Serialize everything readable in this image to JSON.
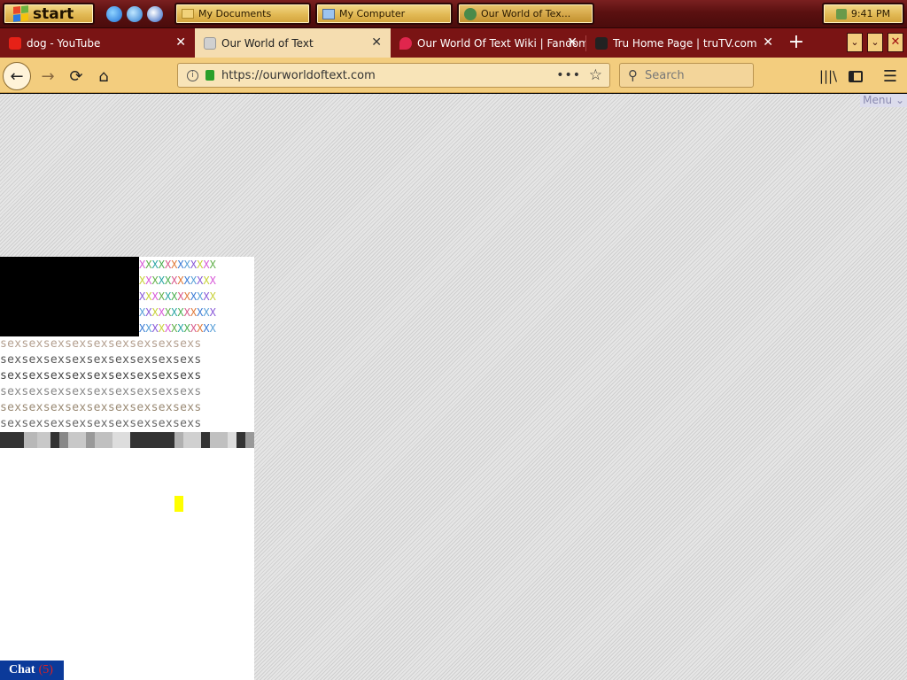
{
  "taskbar": {
    "start_label": "start",
    "windows": [
      {
        "label": "My Documents"
      },
      {
        "label": "My Computer"
      },
      {
        "label": "Our World of Tex..."
      }
    ],
    "clock": "9:41 PM"
  },
  "tabs": [
    {
      "label": "dog - YouTube",
      "icon": "youtube-icon",
      "color": "#e62117"
    },
    {
      "label": "Our World of Text",
      "icon": "page-icon",
      "color": "#9a9a9a"
    },
    {
      "label": "Our World Of Text Wiki | Fandom",
      "icon": "fandom-icon",
      "color": "#e0264d"
    },
    {
      "label": "Tru Home Page | truTV.com",
      "icon": "trutv-icon",
      "color": "#222222"
    }
  ],
  "navbar": {
    "url": "https://ourworldoftext.com",
    "search_placeholder": "Search"
  },
  "page": {
    "menu_label": "Menu",
    "x_rows": [
      "XXXXXXXXXXXX",
      "XXXXXXXXXXXX",
      "XXXXXXXXXXXX",
      "XXXXXXXXXXXX",
      "XXXXXXXXXXXX"
    ],
    "sex_rows": [
      "sexsexsexsexsexsexsexsexsexs",
      "sexsexsexsexsexsexsexsexsexs",
      "sexsexsexsexsexsexsexsexsexs",
      "sexsexsexsexsexsexsexsexsexs",
      "sexsexsexsexsexsexsexsexsexs",
      "sexsexsexsexsexsexsexsexsexs"
    ],
    "chat_label": "Chat",
    "chat_count": "(5)"
  },
  "colors": {
    "x_palette": [
      "#d85ad8",
      "#4caf50",
      "#3a7bd5",
      "#c8d13a",
      "#2ca6a4",
      "#e07a3a",
      "#8a5ad8",
      "#62b04c",
      "#d85a8a",
      "#5aa0d8"
    ],
    "sex_colors": [
      "#b4a090",
      "#555555",
      "#444444",
      "#888888",
      "#9a8a74",
      "#666666"
    ],
    "accent": "#f3cd7e",
    "tab_strip": "#7a1414"
  }
}
